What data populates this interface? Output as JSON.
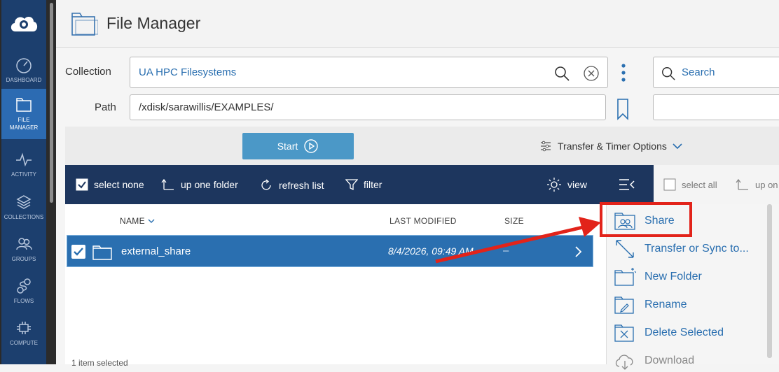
{
  "app": {
    "title": "File Manager"
  },
  "sidebar": {
    "items": [
      {
        "label": "DASHBOARD",
        "icon": "gauge-icon"
      },
      {
        "label": "FILE\nMANAGER",
        "icon": "file-manager-icon",
        "active": true
      },
      {
        "label": "ACTIVITY",
        "icon": "pulse-icon"
      },
      {
        "label": "COLLECTIONS",
        "icon": "layers-icon"
      },
      {
        "label": "GROUPS",
        "icon": "people-icon"
      },
      {
        "label": "FLOWS",
        "icon": "flows-icon"
      },
      {
        "label": "COMPUTE",
        "icon": "compute-icon"
      }
    ]
  },
  "collection": {
    "label": "Collection",
    "value": "UA HPC Filesystems"
  },
  "path": {
    "label": "Path",
    "value": "/xdisk/sarawillis/EXAMPLES/"
  },
  "search": {
    "placeholder": "Search"
  },
  "start_button": {
    "label": "Start"
  },
  "transfer_options": {
    "label": "Transfer & Timer Options"
  },
  "toolbar": {
    "select_none": "select none",
    "up_one_folder": "up one folder",
    "refresh_list": "refresh list",
    "filter": "filter",
    "view": "view"
  },
  "toolbar2": {
    "select_all": "select all",
    "up_one_folder": "up on"
  },
  "table": {
    "columns": {
      "name": "NAME",
      "last_modified": "LAST MODIFIED",
      "size": "SIZE"
    },
    "rows": [
      {
        "name": "external_share",
        "last_modified": "8/4/2026, 09:49 AM",
        "size": "–",
        "selected": true
      }
    ]
  },
  "menu": {
    "share": "Share",
    "transfer": "Transfer or Sync to...",
    "new_folder": "New Folder",
    "rename": "Rename",
    "delete": "Delete Selected",
    "download": "Download"
  },
  "status": {
    "text": "1 item selected"
  },
  "colors": {
    "accent": "#2a6fb0",
    "toolbar": "#1d365e",
    "highlight": "#e2231a",
    "sidebar": "#1c3f6e"
  }
}
